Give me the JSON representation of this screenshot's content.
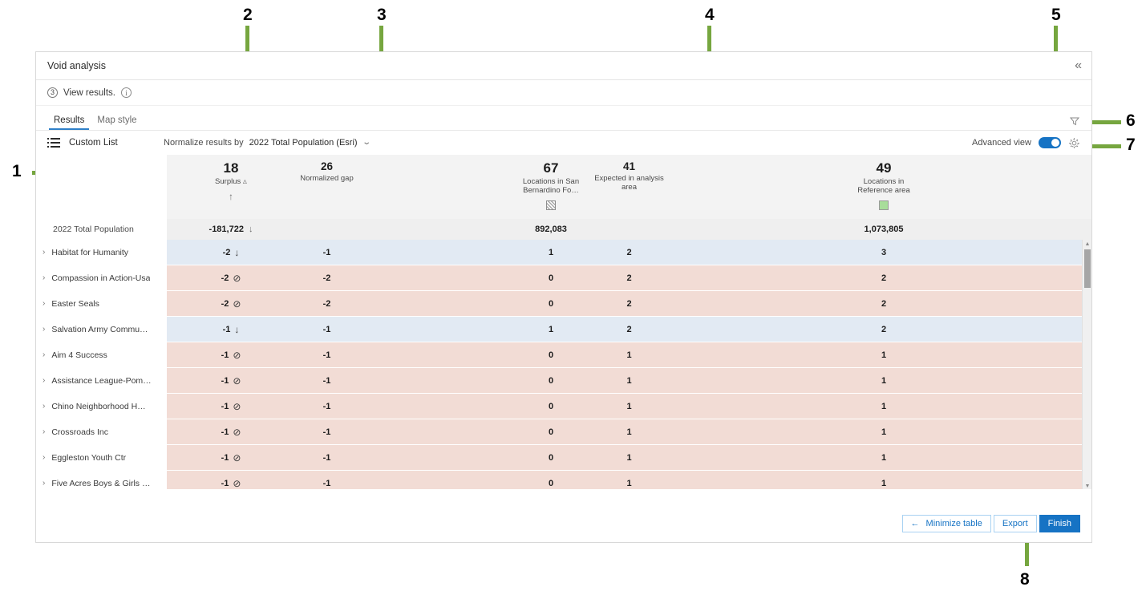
{
  "panel": {
    "title": "Void analysis",
    "collapse_icon": "double-chevron-left-icon",
    "step_number": "3",
    "step_label": "View results.",
    "info_icon": "info-icon"
  },
  "tabs": [
    {
      "label": "Results",
      "active": true
    },
    {
      "label": "Map style",
      "active": false
    }
  ],
  "tabs_right": {
    "filter_icon": "filter-funnel-icon"
  },
  "toolbar": {
    "custom_list_label": "Custom List",
    "list_icon": "bulleted-list-icon",
    "normalize_label": "Normalize results by",
    "normalize_value": "2022 Total Population (Esri)",
    "normalize_chevron": "chevron-down-icon",
    "advanced_view_label": "Advanced view",
    "advanced_view_on": true,
    "gear_icon": "gear-icon"
  },
  "table": {
    "columns": [
      {
        "key": "name",
        "count": "",
        "label": "",
        "sort": "",
        "swatch": ""
      },
      {
        "key": "surplus",
        "count": "18",
        "label": "Surplus",
        "sort": "^",
        "swatch": "arrow-up-icon"
      },
      {
        "key": "norm",
        "count": "26",
        "label": "Normalized gap",
        "sort": "",
        "swatch": ""
      },
      {
        "key": "loc",
        "count": "67",
        "label": "Locations in San Bernardino Fo…",
        "sort": "",
        "swatch": "hatched-square-icon"
      },
      {
        "key": "exp",
        "count": "41",
        "label": "Expected in analysis area",
        "sort": "",
        "swatch": ""
      },
      {
        "key": "ref",
        "count": "49",
        "label": "Locations in Reference area",
        "sort": "",
        "swatch": "green-square-icon"
      }
    ],
    "total_row": {
      "name": "2022 Total Population",
      "surplus": "-181,722",
      "surplus_arrow": "↓",
      "norm": "",
      "loc": "892,083",
      "exp": "",
      "ref": "1,073,805"
    },
    "rows": [
      {
        "name": "Habitat for Humanity",
        "tone": "blue",
        "surplus": "-2",
        "marker": "arrow-down",
        "norm": "-1",
        "loc": "1",
        "exp": "2",
        "ref": "3"
      },
      {
        "name": "Compassion in Action-Usa",
        "tone": "pink",
        "surplus": "-2",
        "marker": "no-entry",
        "norm": "-2",
        "loc": "0",
        "exp": "2",
        "ref": "2"
      },
      {
        "name": "Easter Seals",
        "tone": "pink",
        "surplus": "-2",
        "marker": "no-entry",
        "norm": "-2",
        "loc": "0",
        "exp": "2",
        "ref": "2"
      },
      {
        "name": "Salvation Army Commu…",
        "tone": "blue",
        "surplus": "-1",
        "marker": "arrow-down",
        "norm": "-1",
        "loc": "1",
        "exp": "2",
        "ref": "2"
      },
      {
        "name": "Aim 4 Success",
        "tone": "pink",
        "surplus": "-1",
        "marker": "no-entry",
        "norm": "-1",
        "loc": "0",
        "exp": "1",
        "ref": "1"
      },
      {
        "name": "Assistance League-Pom…",
        "tone": "pink",
        "surplus": "-1",
        "marker": "no-entry",
        "norm": "-1",
        "loc": "0",
        "exp": "1",
        "ref": "1"
      },
      {
        "name": "Chino Neighborhood H…",
        "tone": "pink",
        "surplus": "-1",
        "marker": "no-entry",
        "norm": "-1",
        "loc": "0",
        "exp": "1",
        "ref": "1"
      },
      {
        "name": "Crossroads Inc",
        "tone": "pink",
        "surplus": "-1",
        "marker": "no-entry",
        "norm": "-1",
        "loc": "0",
        "exp": "1",
        "ref": "1"
      },
      {
        "name": "Eggleston Youth Ctr",
        "tone": "pink",
        "surplus": "-1",
        "marker": "no-entry",
        "norm": "-1",
        "loc": "0",
        "exp": "1",
        "ref": "1"
      },
      {
        "name": "Five Acres Boys & Girls …",
        "tone": "pink",
        "surplus": "-1",
        "marker": "no-entry",
        "norm": "-1",
        "loc": "0",
        "exp": "1",
        "ref": "1"
      }
    ],
    "row_chevron": "chevron-right-icon",
    "scrollbar": {
      "up_icon": "scroll-up-arrow-icon",
      "down_icon": "scroll-down-arrow-icon"
    }
  },
  "footer": {
    "minimize_label": "Minimize table",
    "minimize_arrow": "arrow-left-icon",
    "export_label": "Export",
    "finish_label": "Finish"
  },
  "annotations": [
    {
      "id": "1",
      "label": "1"
    },
    {
      "id": "2",
      "label": "2"
    },
    {
      "id": "3",
      "label": "3"
    },
    {
      "id": "4",
      "label": "4"
    },
    {
      "id": "5",
      "label": "5"
    },
    {
      "id": "6",
      "label": "6"
    },
    {
      "id": "7",
      "label": "7"
    },
    {
      "id": "8",
      "label": "8"
    }
  ],
  "colors": {
    "annotation_green": "#76a63f",
    "accent_blue": "#1673c4",
    "row_blue": "#e2eaf3",
    "row_pink": "#f2dcd5",
    "header_gray": "#f3f3f3",
    "reference_green": "#a8dd9a"
  }
}
